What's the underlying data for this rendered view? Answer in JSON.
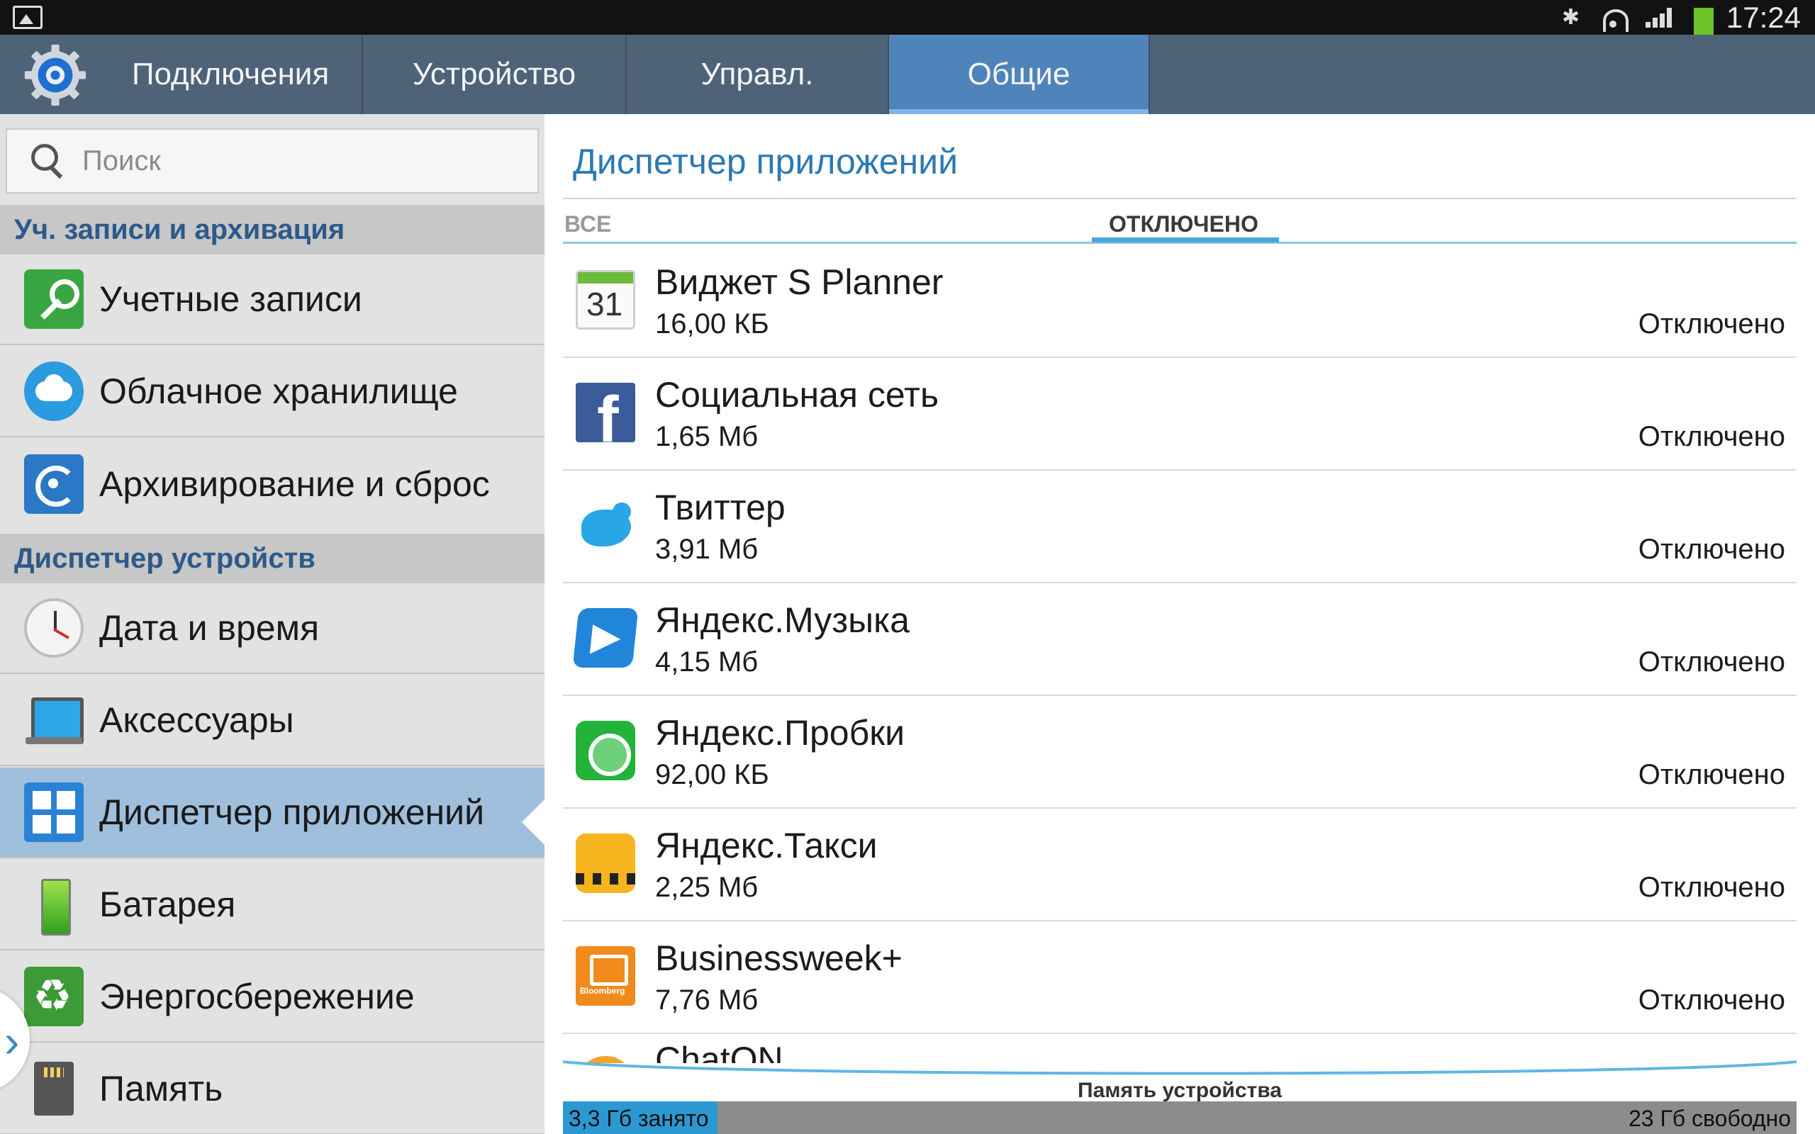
{
  "status_bar": {
    "time": "17:24"
  },
  "tabs": [
    {
      "label": "Подключения"
    },
    {
      "label": "Устройство"
    },
    {
      "label": "Управл."
    },
    {
      "label": "Общие",
      "active": true
    }
  ],
  "sidebar": {
    "search_placeholder": "Поиск",
    "sections": [
      {
        "title": "Уч. записи и архивация"
      },
      {
        "title": "Диспетчер устройств"
      }
    ],
    "items": [
      {
        "label": "Учетные записи",
        "icon": "key-icon"
      },
      {
        "label": "Облачное хранилище",
        "icon": "cloud-icon"
      },
      {
        "label": "Архивирование и сброс",
        "icon": "backup-icon"
      },
      {
        "label": "Дата и время",
        "icon": "clock-icon"
      },
      {
        "label": "Аксессуары",
        "icon": "accessory-icon"
      },
      {
        "label": "Диспетчер приложений",
        "icon": "app-manager-icon",
        "selected": true
      },
      {
        "label": "Батарея",
        "icon": "battery-icon"
      },
      {
        "label": "Энергосбережение",
        "icon": "power-saving-icon"
      },
      {
        "label": "Память",
        "icon": "memory-card-icon"
      }
    ]
  },
  "main": {
    "title": "Диспетчер приложений",
    "subtabs": [
      {
        "label": "ВСЕ"
      },
      {
        "label": "ОТКЛЮЧЕНО",
        "active": true
      }
    ],
    "apps": [
      {
        "name": "Виджет S Planner",
        "size": "16,00 КБ",
        "status": "Отключено",
        "icon": "calendar-icon"
      },
      {
        "name": "Социальная сеть",
        "size": "1,65 Мб",
        "status": "Отключено",
        "icon": "facebook-icon"
      },
      {
        "name": "Твиттер",
        "size": "3,91 Мб",
        "status": "Отключено",
        "icon": "twitter-icon"
      },
      {
        "name": "Яндекс.Музыка",
        "size": "4,15 Мб",
        "status": "Отключено",
        "icon": "yandex-music-icon"
      },
      {
        "name": "Яндекс.Пробки",
        "size": "92,00 КБ",
        "status": "Отключено",
        "icon": "yandex-traffic-icon"
      },
      {
        "name": "Яндекс.Такси",
        "size": "2,25 Мб",
        "status": "Отключено",
        "icon": "yandex-taxi-icon"
      },
      {
        "name": "Businessweek+",
        "size": "7,76 Мб",
        "status": "Отключено",
        "icon": "businessweek-icon"
      },
      {
        "name": "ChatON",
        "size": "",
        "status": "",
        "icon": "chaton-icon"
      }
    ],
    "storage": {
      "label": "Память устройства",
      "used": "3,3 Гб занято",
      "free": "23 Гб свободно",
      "used_fraction": 0.125
    }
  }
}
